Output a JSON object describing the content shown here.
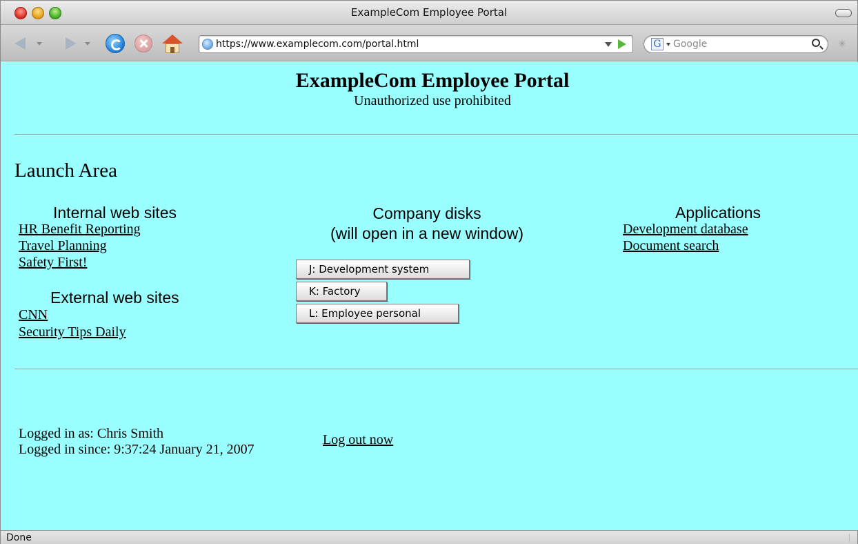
{
  "window": {
    "title": "ExampleCom Employee Portal"
  },
  "toolbar": {
    "url": "https://www.examplecom.com/portal.html",
    "search_placeholder": "Google"
  },
  "page": {
    "title": "ExampleCom Employee Portal",
    "subtitle": "Unauthorized use prohibited",
    "launch_heading": "Launch Area",
    "internal": {
      "heading": "Internal web sites",
      "links": [
        "HR Benefit Reporting",
        "Travel Planning",
        "Safety First!"
      ]
    },
    "external": {
      "heading": "External web sites",
      "links": [
        "CNN",
        "Security Tips Daily"
      ]
    },
    "disks": {
      "heading_line1": "Company disks",
      "heading_line2": "(will open in a new window)",
      "buttons": [
        "J: Development system",
        "K: Factory",
        "L: Employee personal"
      ]
    },
    "applications": {
      "heading": "Applications",
      "links": [
        "Development database",
        "Document search"
      ]
    },
    "session": {
      "logged_in_as": "Logged in as: Chris Smith",
      "logged_in_since": "Logged in since: 9:37:24 January 21, 2007",
      "logout_label": "Log out now"
    }
  },
  "statusbar": {
    "text": "Done"
  }
}
